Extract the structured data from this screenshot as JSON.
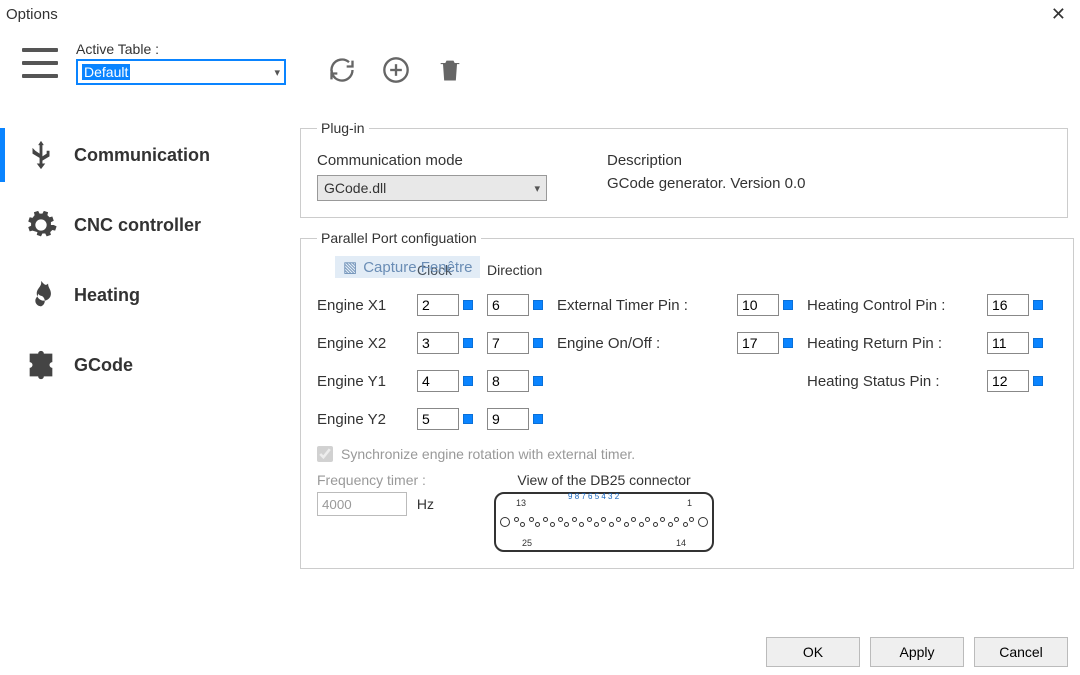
{
  "window": {
    "title": "Options"
  },
  "topbar": {
    "active_table_label": "Active Table :",
    "active_table_value": "Default"
  },
  "sidebar": {
    "items": [
      {
        "id": "communication",
        "label": "Communication"
      },
      {
        "id": "cnc",
        "label": "CNC controller"
      },
      {
        "id": "heating",
        "label": "Heating"
      },
      {
        "id": "gcode",
        "label": "GCode"
      }
    ]
  },
  "plugin": {
    "legend": "Plug-in",
    "mode_label": "Communication mode",
    "mode_value": "GCode.dll",
    "desc_label": "Description",
    "desc_value": "GCode generator. Version 0.0"
  },
  "overlay_hint": "Capture Fenêtre",
  "parallel": {
    "legend": "Parallel Port configuation",
    "col_clock": "Clock",
    "col_direction": "Direction",
    "row_labels": [
      "Engine X1",
      "Engine X2",
      "Engine Y1",
      "Engine Y2"
    ],
    "clock_vals": [
      "2",
      "3",
      "4",
      "5"
    ],
    "dir_vals": [
      "6",
      "7",
      "8",
      "9"
    ],
    "ext_timer_label": "External Timer Pin :",
    "ext_timer_val": "10",
    "engine_on_label": "Engine On/Off :",
    "engine_on_val": "17",
    "heat_ctrl_label": "Heating Control Pin :",
    "heat_ctrl_val": "16",
    "heat_ret_label": "Heating Return Pin :",
    "heat_ret_val": "11",
    "heat_stat_label": "Heating Status Pin :",
    "heat_stat_val": "12",
    "sync_label": "Synchronize engine rotation with external timer.",
    "freq_label": "Frequency timer :",
    "freq_val": "4000",
    "freq_unit": "Hz",
    "db25_title": "View of the DB25 connector"
  },
  "footer": {
    "ok": "OK",
    "apply": "Apply",
    "cancel": "Cancel"
  }
}
